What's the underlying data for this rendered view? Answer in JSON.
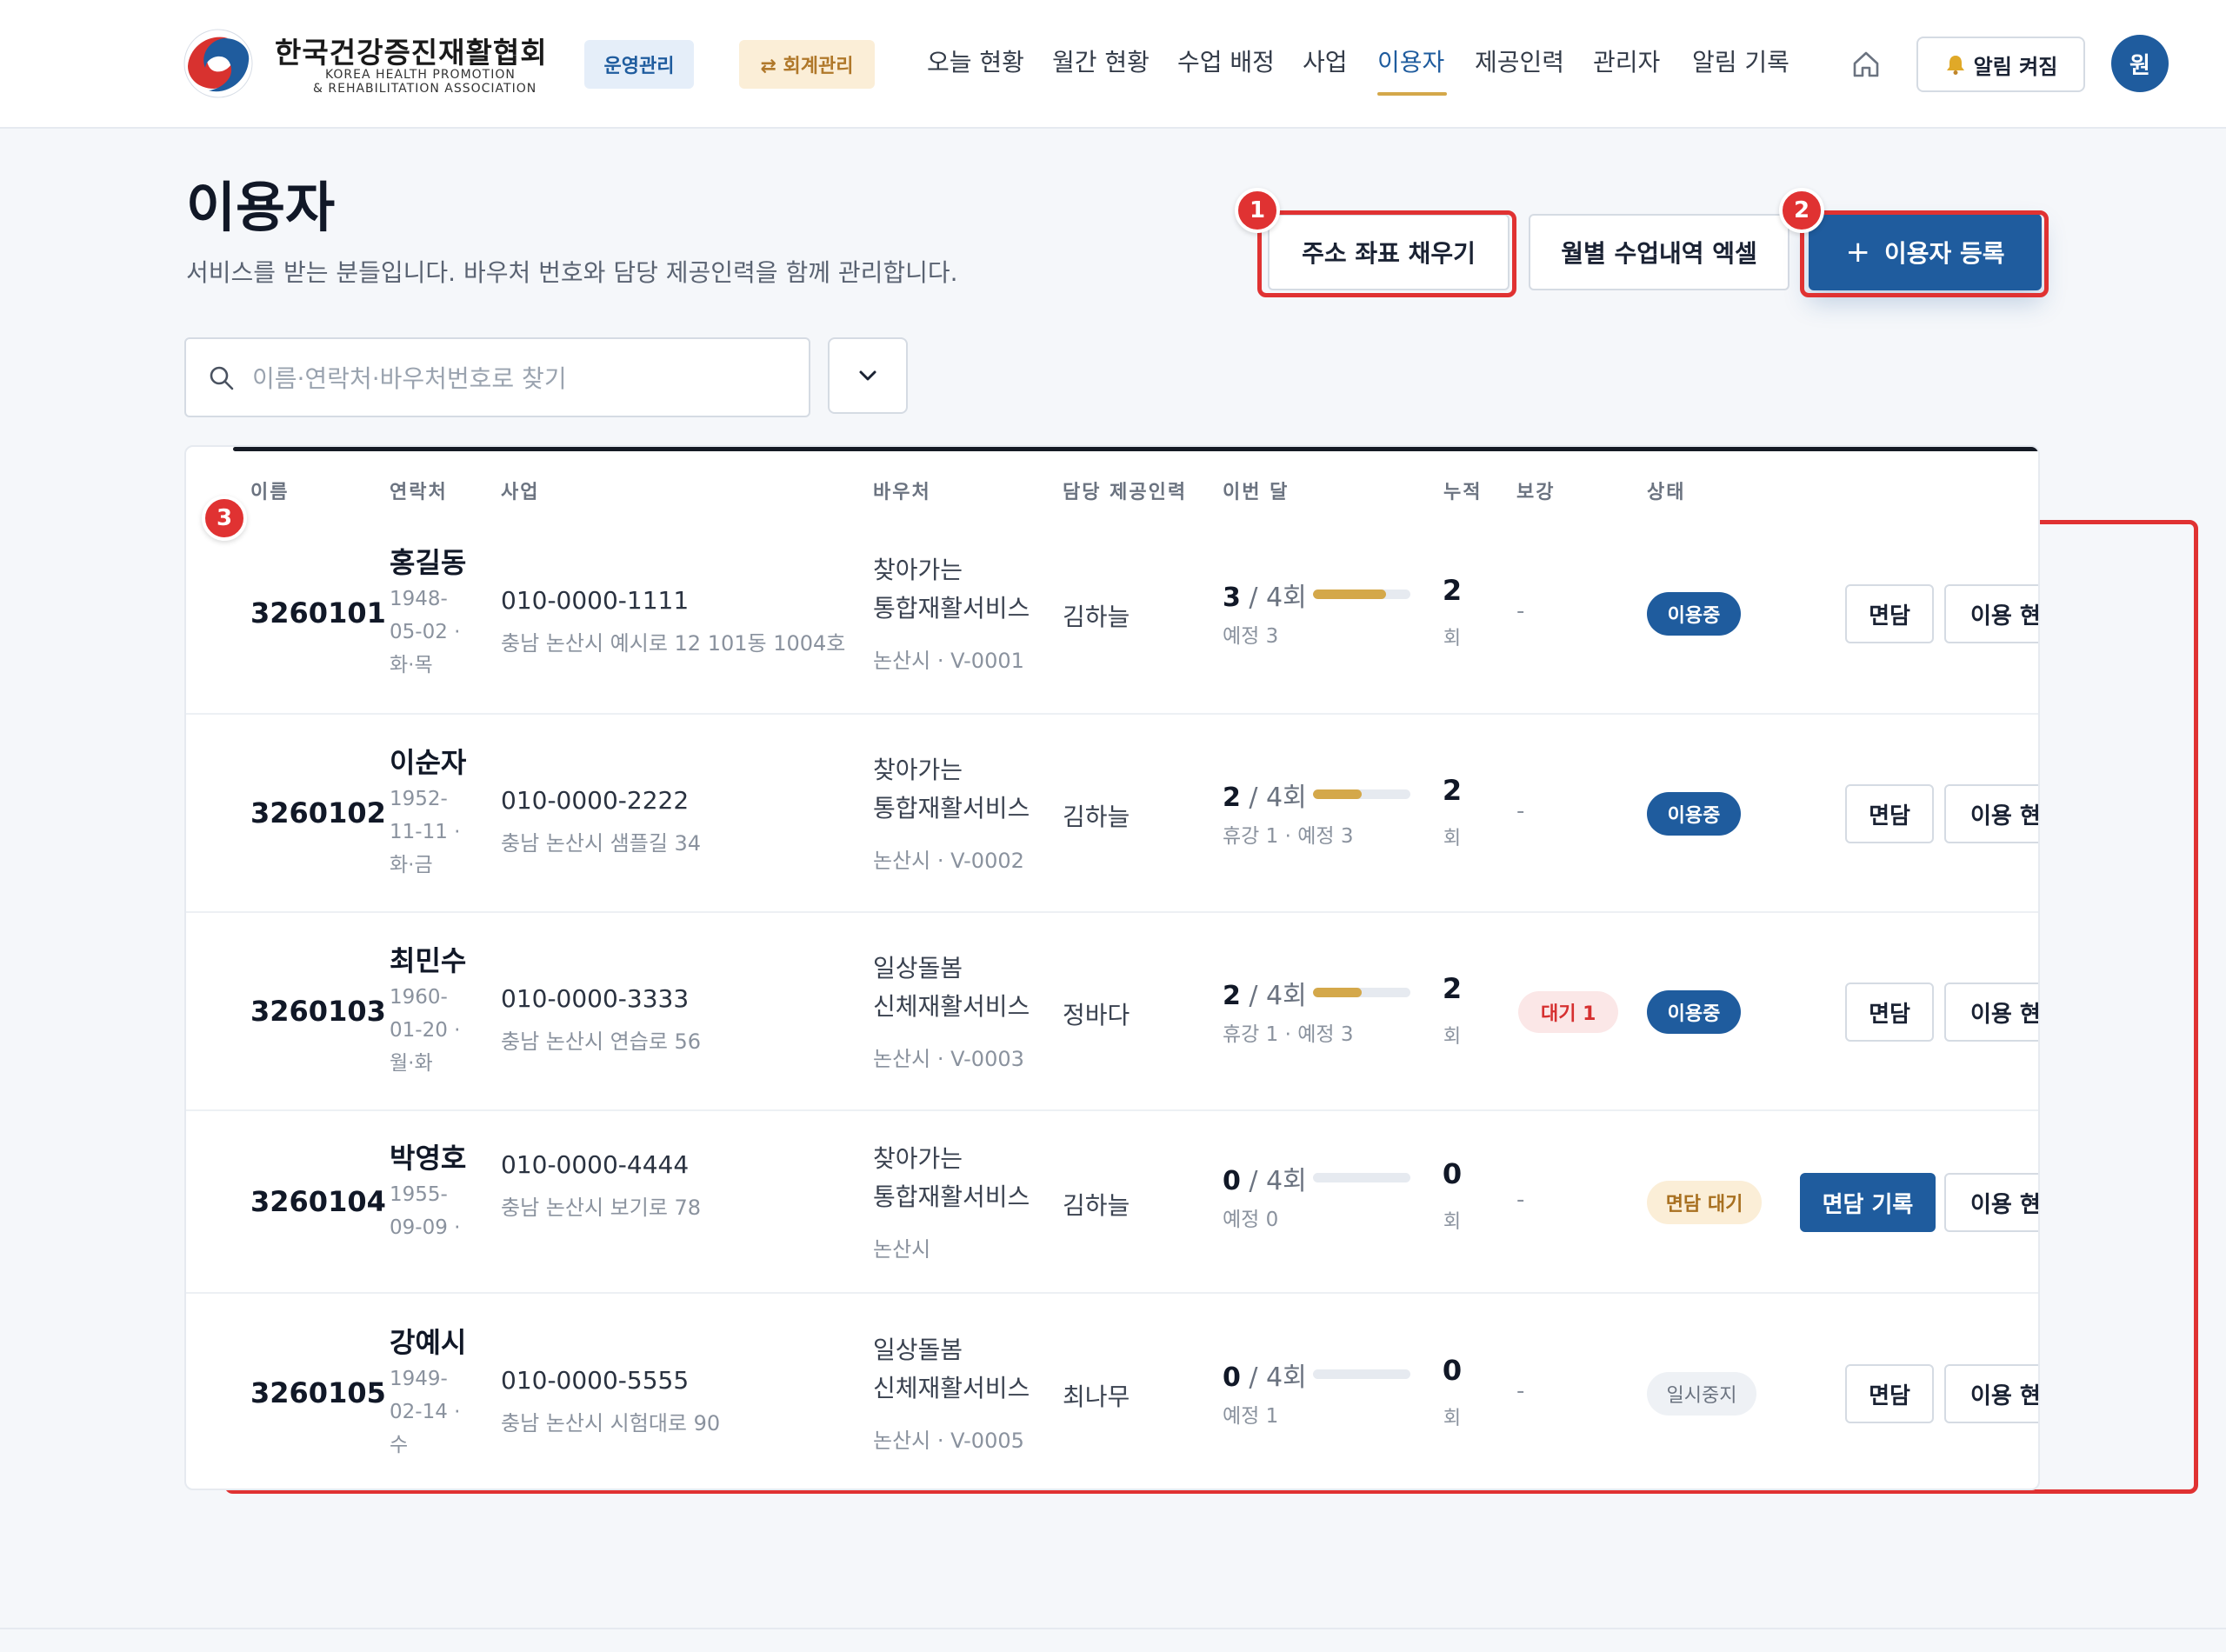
{
  "header": {
    "org_name": "한국건강증진재활협회",
    "org_sub1": "KOREA HEALTH PROMOTION",
    "org_sub2": "& REHABILITATION ASSOCIATION",
    "mode_ops": "운영관리",
    "mode_accounting": "⇄ 회계관리",
    "nav": [
      "오늘 현황",
      "월간 현황",
      "수업 배정",
      "사업",
      "이용자",
      "제공인력",
      "관리자",
      "알림 기록"
    ],
    "active_nav": "이용자",
    "alert_label": "알림 켜짐",
    "avatar": "원",
    "accent_color": "#1f5c9e",
    "highlight_color": "#d4a84a"
  },
  "page": {
    "title": "이용자",
    "description": "서비스를 받는 분들입니다. 바우처 번호와 담당 제공인력을 함께 관리합니다."
  },
  "actions": {
    "fill_coords": "주소 좌표 채우기",
    "monthly_excel": "월별 수업내역 엑셀",
    "register_plus": "+",
    "register": "이용자 등록"
  },
  "annotations": {
    "m1": "1",
    "m2": "2",
    "m3": "3",
    "color": "#e03232"
  },
  "search": {
    "placeholder": "이름·연락처·바우처번호로 찾기",
    "value": ""
  },
  "table": {
    "headers": [
      "이름",
      "연락처",
      "사업",
      "바우처",
      "담당 제공인력",
      "이번 달",
      "누적",
      "보강",
      "상태"
    ],
    "rows": [
      {
        "id": "3260101",
        "name": "홍길동",
        "birth1": "1948-",
        "birth2": "05-02 ·",
        "birth3": "화·목",
        "phone": "010-0000-1111",
        "address": "충남 논산시 예시로 12 101동 1004호",
        "svc1": "찾아가는",
        "svc2": "통합재활서비스",
        "voucher": "논산시 · V-0001",
        "staff": "김하늘",
        "month_done": "3",
        "month_total": " / 4회",
        "progress": 0.75,
        "month_sub": "예정 3",
        "cumulative": "2",
        "cum_unit": "회",
        "makeup": "-",
        "status": "이용중",
        "status_type": "active",
        "interview_label": "면담",
        "interview_primary": false,
        "usage_label": "이용 현황"
      },
      {
        "id": "3260102",
        "name": "이순자",
        "birth1": "1952-",
        "birth2": "11-11 ·",
        "birth3": "화·금",
        "phone": "010-0000-2222",
        "address": "충남 논산시 샘플길 34",
        "svc1": "찾아가는",
        "svc2": "통합재활서비스",
        "voucher": "논산시 · V-0002",
        "staff": "김하늘",
        "month_done": "2",
        "month_total": " / 4회",
        "progress": 0.5,
        "month_sub": "휴강 1 · 예정 3",
        "cumulative": "2",
        "cum_unit": "회",
        "makeup": "-",
        "status": "이용중",
        "status_type": "active",
        "interview_label": "면담",
        "interview_primary": false,
        "usage_label": "이용 현황"
      },
      {
        "id": "3260103",
        "name": "최민수",
        "birth1": "1960-",
        "birth2": "01-20 ·",
        "birth3": "월·화",
        "phone": "010-0000-3333",
        "address": "충남 논산시 연습로 56",
        "svc1": "일상돌봄",
        "svc2": "신체재활서비스",
        "voucher": "논산시 · V-0003",
        "staff": "정바다",
        "month_done": "2",
        "month_total": " / 4회",
        "progress": 0.5,
        "month_sub": "휴강 1 · 예정 3",
        "cumulative": "2",
        "cum_unit": "회",
        "makeup": "대기 1",
        "status": "이용중",
        "status_type": "active",
        "interview_label": "면담",
        "interview_primary": false,
        "usage_label": "이용 현황"
      },
      {
        "id": "3260104",
        "name": "박영호",
        "birth1": "1955-",
        "birth2": "09-09 ·",
        "birth3": "",
        "phone": "010-0000-4444",
        "address": "충남 논산시 보기로 78",
        "svc1": "찾아가는",
        "svc2": "통합재활서비스",
        "voucher": "논산시",
        "staff": "김하늘",
        "month_done": "0",
        "month_total": " / 4회",
        "progress": 0,
        "month_sub": "예정 0",
        "cumulative": "0",
        "cum_unit": "회",
        "makeup": "-",
        "status": "면담 대기",
        "status_type": "wait",
        "interview_label": "면담 기록",
        "interview_primary": true,
        "usage_label": "이용 현황"
      },
      {
        "id": "3260105",
        "name": "강예시",
        "birth1": "1949-",
        "birth2": "02-14 ·",
        "birth3": "수",
        "phone": "010-0000-5555",
        "address": "충남 논산시 시험대로 90",
        "svc1": "일상돌봄",
        "svc2": "신체재활서비스",
        "voucher": "논산시 · V-0005",
        "staff": "최나무",
        "month_done": "0",
        "month_total": " / 4회",
        "progress": 0,
        "month_sub": "예정 1",
        "cumulative": "0",
        "cum_unit": "회",
        "makeup": "-",
        "status": "일시중지",
        "status_type": "pause",
        "interview_label": "면담",
        "interview_primary": false,
        "usage_label": "이용 현황"
      }
    ]
  }
}
